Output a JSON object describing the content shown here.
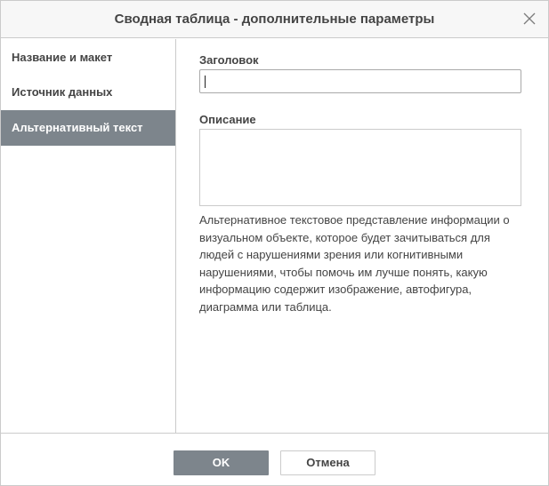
{
  "dialog": {
    "title": "Сводная таблица - дополнительные параметры"
  },
  "sidebar": {
    "items": [
      {
        "label": "Название и макет",
        "active": false
      },
      {
        "label": "Источник данных",
        "active": false
      },
      {
        "label": "Альтернативный текст",
        "active": true
      }
    ]
  },
  "alt_text": {
    "title_label": "Заголовок",
    "title_value": "",
    "description_label": "Описание",
    "description_value": "",
    "hint": "Альтернативное текстовое представление информации о визуальном объекте, которое будет зачитываться для людей с нарушениями зрения или когнитивными нарушениями, чтобы помочь им лучше понять, какую информацию содержит изображение, автофигура, диаграмма или таблица."
  },
  "footer": {
    "ok_label": "OK",
    "cancel_label": "Отмена"
  },
  "colors": {
    "accent": "#7d858c",
    "border": "#cbcbcb",
    "text": "#444444",
    "titlebar_bg": "#f7f7f7"
  },
  "icons": {
    "close": "close-icon"
  }
}
